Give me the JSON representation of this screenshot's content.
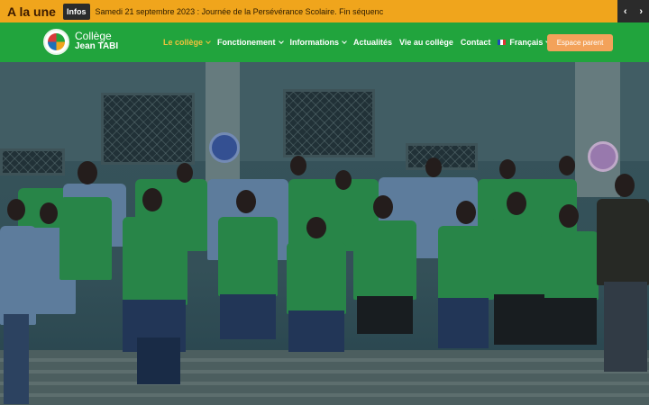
{
  "ticker": {
    "title": "A la une",
    "badge": "Infos",
    "text": "Samedi 21 septembre 2023 : Journée de la Persévérance Scolaire. Fin séquenc",
    "prev": "‹",
    "next": "›"
  },
  "brand": {
    "line1": "Collège",
    "line2": "Jean TABI"
  },
  "menu": [
    {
      "label": "Le collège",
      "has_dropdown": true,
      "active": true
    },
    {
      "label": "Fonctionement",
      "has_dropdown": true,
      "active": false
    },
    {
      "label": "Informations",
      "has_dropdown": true,
      "active": false
    },
    {
      "label": "Actualités",
      "has_dropdown": false,
      "active": false
    },
    {
      "label": "Vie au collège",
      "has_dropdown": false,
      "active": false
    },
    {
      "label": "Contact",
      "has_dropdown": false,
      "active": false
    },
    {
      "label": "Français",
      "has_dropdown": true,
      "active": false
    }
  ],
  "cta": {
    "label": "Espace parent"
  },
  "colors": {
    "ticker_bg": "#f0a51c",
    "nav_bg": "#21a43d",
    "active_menu": "#f0c23c",
    "cta_bg": "#f3a25a"
  },
  "hero": {
    "image": "group-photo-students-green-uniforms"
  }
}
